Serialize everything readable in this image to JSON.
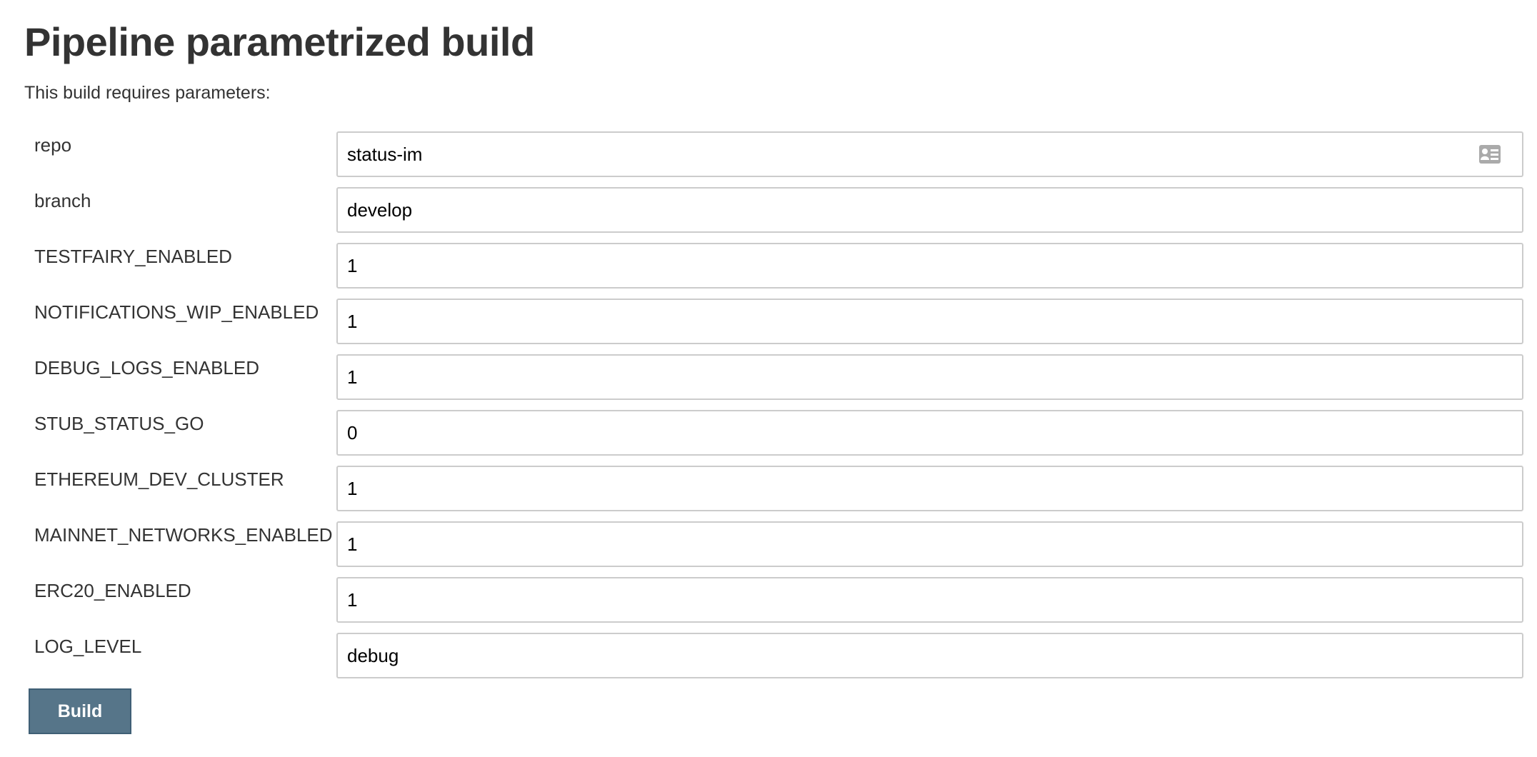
{
  "page": {
    "title": "Pipeline parametrized build",
    "subtitle": "This build requires parameters:"
  },
  "params": [
    {
      "label": "repo",
      "value": "status-im",
      "icon": "contact-card-icon"
    },
    {
      "label": "branch",
      "value": "develop"
    },
    {
      "label": "TESTFAIRY_ENABLED",
      "value": "1"
    },
    {
      "label": "NOTIFICATIONS_WIP_ENABLED",
      "value": "1"
    },
    {
      "label": "DEBUG_LOGS_ENABLED",
      "value": "1"
    },
    {
      "label": "STUB_STATUS_GO",
      "value": "0"
    },
    {
      "label": "ETHEREUM_DEV_CLUSTER",
      "value": "1"
    },
    {
      "label": "MAINNET_NETWORKS_ENABLED",
      "value": "1"
    },
    {
      "label": "ERC20_ENABLED",
      "value": "1"
    },
    {
      "label": "LOG_LEVEL",
      "value": "debug"
    }
  ],
  "actions": {
    "build_label": "Build"
  },
  "colors": {
    "build_button_bg": "#567589",
    "input_border": "#cccccc",
    "text": "#333333"
  }
}
